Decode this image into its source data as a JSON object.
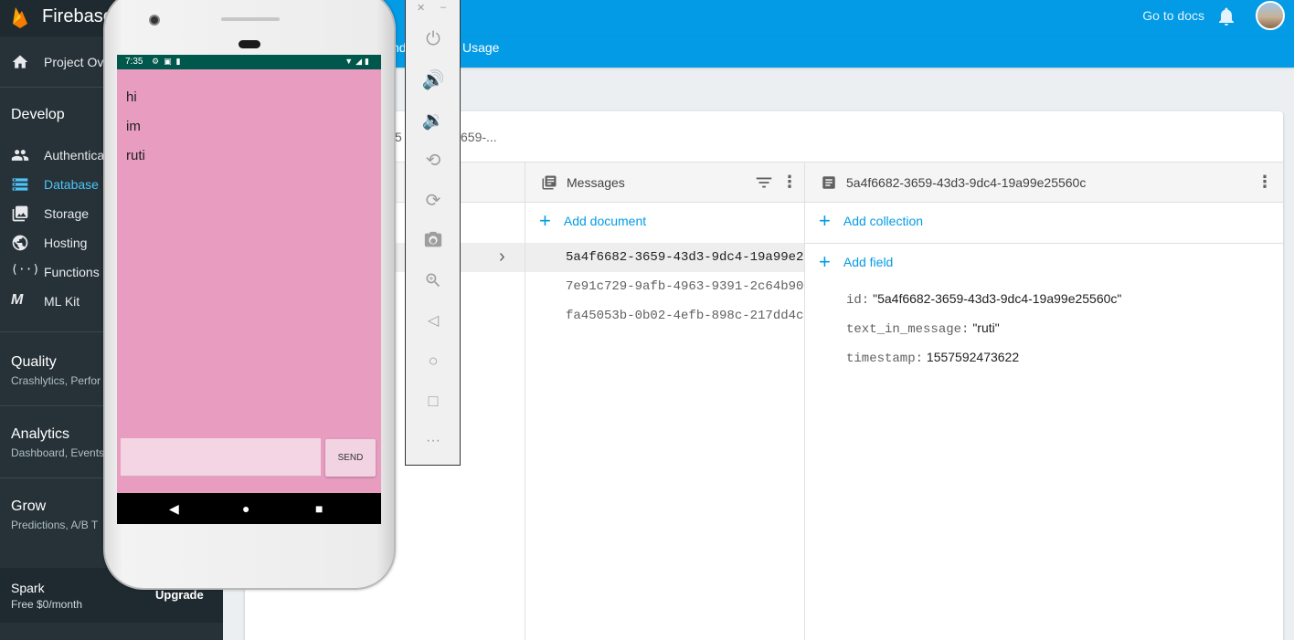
{
  "topbar": {
    "go_to_docs": "Go to docs"
  },
  "subbar": {
    "tab_partial": "nd",
    "tab_usage": "Usage"
  },
  "sidebar": {
    "brand": "Firebase",
    "project_overview": "Project Ov",
    "develop_title": "Develop",
    "develop_items": [
      {
        "label": "Authentica",
        "icon": "people-icon"
      },
      {
        "label": "Database",
        "icon": "database-icon"
      },
      {
        "label": "Storage",
        "icon": "storage-icon"
      },
      {
        "label": "Hosting",
        "icon": "globe-icon"
      },
      {
        "label": "Functions",
        "icon": "functions-icon"
      },
      {
        "label": "ML Kit",
        "icon": "mlkit-icon"
      }
    ],
    "quality_title": "Quality",
    "quality_sub": "Crashlytics, Perfor",
    "analytics_title": "Analytics",
    "analytics_sub": "Dashboard, Events",
    "grow_title": "Grow",
    "grow_sub": "Predictions, A/B T",
    "spark_plan": "Spark",
    "spark_price": "Free $0/month",
    "upgrade": "Upgrade",
    "active_color": "#4fc3f7"
  },
  "firestore": {
    "path_partial": "659-...",
    "path_prefix": "5",
    "messages_header": "Messages",
    "doc_header": "5a4f6682-3659-43d3-9dc4-19a99e25560c",
    "add_document": "Add document",
    "add_collection": "Add collection",
    "add_field": "Add field",
    "documents": [
      "5a4f6682-3659-43d3-9dc4-19a99e2",
      "7e91c729-9afb-4963-9391-2c64b90",
      "fa45053b-0b02-4efb-898c-217dd4c"
    ],
    "fields": [
      {
        "key": "id:",
        "value": "\"5a4f6682-3659-43d3-9dc4-19a99e25560c\""
      },
      {
        "key": "text_in_message:",
        "value": "\"ruti\""
      },
      {
        "key": "timestamp:",
        "value": "1557592473622"
      }
    ]
  },
  "phone": {
    "time": "7:35",
    "messages": [
      "hi",
      "im",
      "ruti"
    ],
    "send": "SEND",
    "screen_color": "#e79cc0",
    "status_color": "#00574b"
  }
}
